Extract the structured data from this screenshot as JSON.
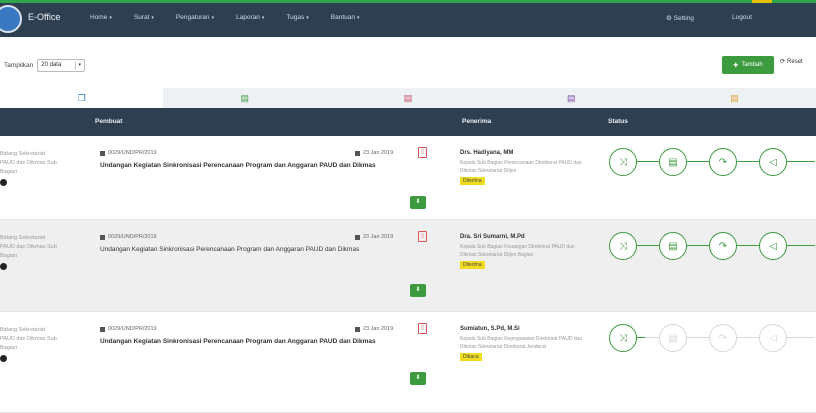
{
  "navbar": {
    "brand": "E-Office",
    "menu": [
      {
        "label": "Home"
      },
      {
        "label": "Surat"
      },
      {
        "label": "Pengaturan"
      },
      {
        "label": "Laporan"
      },
      {
        "label": "Tugas"
      },
      {
        "label": "Bantuan"
      }
    ],
    "setting_label": "Setting",
    "logout_label": "Logout"
  },
  "toolbar": {
    "show_label": "Tampilkan",
    "page_size": "20 data",
    "add_label": "Tambah",
    "reset_label": "Reset"
  },
  "tabs": [
    {
      "icon": "inbox-doc-icon",
      "color": "#2f6fc6"
    },
    {
      "icon": "green-doc-icon",
      "color": "#3c9a3f"
    },
    {
      "icon": "red-doc-icon",
      "color": "#c84a5a"
    },
    {
      "icon": "purple-doc-icon",
      "color": "#7a4fa8"
    },
    {
      "icon": "yellow-doc-icon",
      "color": "#e0a030"
    }
  ],
  "table": {
    "headers": {
      "pembuat": "Pembuat",
      "penerima": "Penerima",
      "status": "Status"
    },
    "rows": [
      {
        "meta": "0029/UND/PR/2019",
        "date": "23 Jan 2019",
        "subject": "Undangan Kegiatan Sinkronisasi Perencanaan Program dan Anggaran PAUD dan Dikmas",
        "left_text": "Bidang Sekretariat PAUD dan Dikmas Sub Bagian",
        "recipient_name": "Drs. Hadiyana, MM",
        "recipient_desc": "Kepala Sub Bagian Perencanaan Direktorat PAUD dan Dikmas Sekretariat Ditjen",
        "badge": "Diterima",
        "status_steps": 4
      },
      {
        "meta": "0029/UND/PR/2019",
        "date": "23 Jan 2019",
        "subject": "Undangan Kegiatan Sinkronisasi Perencanaan Program dan Anggaran PAUD dan Dikmas",
        "left_text": "Bidang Sekretariat PAUD dan Dikmas Sub Bagian",
        "recipient_name": "Dra. Sri Sumarni, M.Pd",
        "recipient_desc": "Kepala Sub Bagian Keuangan Direktorat PAUD dan Dikmas Sekretariat Ditjen Bagian",
        "badge": "Diterima",
        "status_steps": 4
      },
      {
        "meta": "0029/UND/PR/2019",
        "date": "23 Jan 2019",
        "subject": "Undangan Kegiatan Sinkronisasi Perencanaan Program dan Anggaran PAUD dan Dikmas",
        "left_text": "Bidang Sekretariat PAUD dan Dikmas Sub Bagian",
        "recipient_name": "Sumiatun, S.Pd, M.Si",
        "recipient_desc": "Kepala Sub Bagian Kepegawaian Direktorat PAUD dan Dikmas Sekretariat Direktorat Jenderal",
        "badge": "Dibaca",
        "status_steps": 1
      }
    ]
  },
  "colors": {
    "navbar": "#2f3f52",
    "accent_green": "#3c9a3f",
    "badge_yellow": "#f0dc20"
  }
}
